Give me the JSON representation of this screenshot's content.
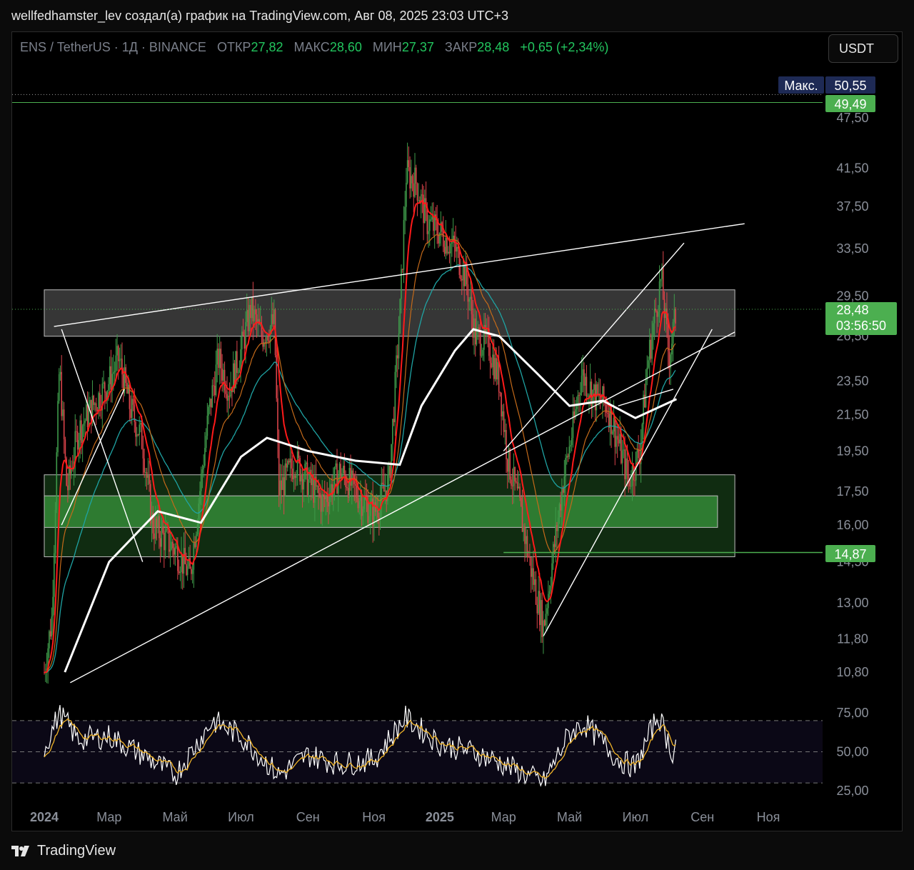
{
  "header": {
    "caption": "wellfedhamster_lev создал(а) график на TradingView.com, Авг 08, 2025 23:03 UTC+3"
  },
  "legend": {
    "symbol": "ENS / TetherUS · 1Д · BINANCE",
    "open_label": "ОТКР",
    "open_value": "27,82",
    "high_label": "МАКС",
    "high_value": "28,60",
    "low_label": "МИН",
    "low_value": "27,37",
    "close_label": "ЗАКР",
    "close_value": "28,48",
    "change": "+0,65 (+2,34%)"
  },
  "currency_button": "USDT",
  "footer": {
    "brand": "TradingView"
  },
  "colors": {
    "up": "#26a69a",
    "down": "#ef5350",
    "green_line": "#4caf50",
    "ema_fast": "#ff1a1a",
    "ema_mid": "#c46a1a",
    "ema_slow": "#1fa3a3",
    "sma_long": "#ffffff",
    "rsi": "#ffffff",
    "rsi_ma": "#f0b429",
    "zone_grey": "#6b6b6b",
    "zone_green": "#2e7d32"
  },
  "chart_data": {
    "type": "candlestick",
    "symbol": "ENS / TetherUS",
    "interval": "1Д",
    "exchange": "BINANCE",
    "y_scale": "log",
    "x_ticks": [
      "2024",
      "Мар",
      "Май",
      "Июл",
      "Сен",
      "Ноя",
      "2025",
      "Мар",
      "Май",
      "Июл",
      "Сен",
      "Ноя"
    ],
    "y_ticks": [
      "47,50",
      "41,50",
      "37,50",
      "33,50",
      "29,50",
      "26,50",
      "23,50",
      "21,50",
      "19,50",
      "17,50",
      "16,00",
      "14,50",
      "13,00",
      "11,80",
      "10,80"
    ],
    "price_labels": [
      {
        "label": "Макс.",
        "value": "50,55"
      },
      {
        "label": "",
        "value": "49,49"
      },
      {
        "label": "",
        "value": "28,48"
      },
      {
        "label": "",
        "value": "03:56:50"
      },
      {
        "label": "",
        "value": "14,87"
      }
    ],
    "close_path": [
      [
        "2024-01-01",
        10.8
      ],
      [
        "2024-01-08",
        12.5
      ],
      [
        "2024-01-15",
        24.5
      ],
      [
        "2024-01-22",
        17.5
      ],
      [
        "2024-02-01",
        20.5
      ],
      [
        "2024-02-15",
        22.0
      ],
      [
        "2024-03-01",
        23.5
      ],
      [
        "2024-03-10",
        25.0
      ],
      [
        "2024-03-20",
        22.0
      ],
      [
        "2024-04-01",
        20.0
      ],
      [
        "2024-04-10",
        16.0
      ],
      [
        "2024-04-20",
        15.5
      ],
      [
        "2024-05-01",
        15.0
      ],
      [
        "2024-05-15",
        14.0
      ],
      [
        "2024-06-01",
        21.5
      ],
      [
        "2024-06-10",
        25.0
      ],
      [
        "2024-06-20",
        23.0
      ],
      [
        "2024-07-01",
        25.5
      ],
      [
        "2024-07-10",
        28.5
      ],
      [
        "2024-07-20",
        26.5
      ],
      [
        "2024-08-01",
        27.5
      ],
      [
        "2024-08-05",
        17.5
      ],
      [
        "2024-08-20",
        19.0
      ],
      [
        "2024-09-01",
        18.0
      ],
      [
        "2024-09-15",
        17.0
      ],
      [
        "2024-10-01",
        18.5
      ],
      [
        "2024-10-15",
        17.5
      ],
      [
        "2024-11-01",
        16.5
      ],
      [
        "2024-11-15",
        18.0
      ],
      [
        "2024-11-25",
        28.0
      ],
      [
        "2024-12-01",
        41.0
      ],
      [
        "2024-12-10",
        40.0
      ],
      [
        "2024-12-20",
        36.0
      ],
      [
        "2025-01-01",
        35.0
      ],
      [
        "2025-01-15",
        33.5
      ],
      [
        "2025-01-25",
        31.0
      ],
      [
        "2025-02-03",
        26.5
      ],
      [
        "2025-02-15",
        26.0
      ],
      [
        "2025-02-25",
        23.5
      ],
      [
        "2025-03-05",
        19.0
      ],
      [
        "2025-03-15",
        17.0
      ],
      [
        "2025-03-25",
        14.5
      ],
      [
        "2025-04-07",
        12.2
      ],
      [
        "2025-04-15",
        14.5
      ],
      [
        "2025-04-25",
        18.0
      ],
      [
        "2025-05-05",
        21.0
      ],
      [
        "2025-05-12",
        24.0
      ],
      [
        "2025-05-25",
        22.5
      ],
      [
        "2025-06-05",
        22.0
      ],
      [
        "2025-06-15",
        20.0
      ],
      [
        "2025-06-25",
        18.0
      ],
      [
        "2025-07-05",
        19.5
      ],
      [
        "2025-07-12",
        24.5
      ],
      [
        "2025-07-20",
        28.5
      ],
      [
        "2025-07-25",
        31.0
      ],
      [
        "2025-08-01",
        25.0
      ],
      [
        "2025-08-08",
        28.48
      ]
    ],
    "sma_long": [
      [
        "2024-01-20",
        10.8
      ],
      [
        "2024-03-01",
        14.5
      ],
      [
        "2024-04-15",
        16.6
      ],
      [
        "2024-05-25",
        16.1
      ],
      [
        "2024-07-01",
        19.2
      ],
      [
        "2024-07-25",
        20.2
      ],
      [
        "2024-09-01",
        19.5
      ],
      [
        "2024-10-15",
        19.0
      ],
      [
        "2024-11-25",
        18.8
      ],
      [
        "2024-12-15",
        22.0
      ],
      [
        "2025-01-15",
        25.5
      ],
      [
        "2025-02-01",
        27.0
      ],
      [
        "2025-02-25",
        26.5
      ],
      [
        "2025-04-01",
        24.0
      ],
      [
        "2025-05-01",
        22.0
      ],
      [
        "2025-06-01",
        22.3
      ],
      [
        "2025-07-01",
        21.3
      ],
      [
        "2025-08-08",
        22.4
      ]
    ],
    "horizontal_levels": [
      {
        "value": 49.49,
        "style": "green"
      },
      {
        "value": 50.55,
        "style": "dotted"
      },
      {
        "value": 28.48,
        "style": "green-dotted"
      },
      {
        "value": 14.87,
        "style": "green-short"
      }
    ],
    "zones": [
      {
        "type": "grey",
        "from": 26.5,
        "to": 30.0,
        "x_from": "2024-01-01",
        "x_to": "2025-10-01"
      },
      {
        "type": "green",
        "from": 14.7,
        "to": 18.3,
        "x_from": "2024-01-01",
        "x_to": "2025-10-01"
      },
      {
        "type": "green-inner",
        "from": 15.9,
        "to": 17.3,
        "x_from": "2024-01-01",
        "x_to": "2025-09-15"
      }
    ],
    "rsi": {
      "levels": [
        "75,00",
        "50,00",
        "25,00"
      ],
      "range": [
        25,
        75
      ],
      "path": [
        [
          "2024-01-01",
          52
        ],
        [
          "2024-01-15",
          75
        ],
        [
          "2024-02-01",
          58
        ],
        [
          "2024-03-01",
          60
        ],
        [
          "2024-04-01",
          48
        ],
        [
          "2024-05-01",
          35
        ],
        [
          "2024-06-05",
          70
        ],
        [
          "2024-07-01",
          60
        ],
        [
          "2024-08-05",
          35
        ],
        [
          "2024-09-01",
          48
        ],
        [
          "2024-10-01",
          42
        ],
        [
          "2024-11-01",
          45
        ],
        [
          "2024-11-30",
          72
        ],
        [
          "2025-01-01",
          55
        ],
        [
          "2025-02-01",
          50
        ],
        [
          "2025-03-01",
          42
        ],
        [
          "2025-04-07",
          30
        ],
        [
          "2025-05-01",
          62
        ],
        [
          "2025-05-15",
          68
        ],
        [
          "2025-06-15",
          45
        ],
        [
          "2025-07-01",
          40
        ],
        [
          "2025-07-22",
          74
        ],
        [
          "2025-08-05",
          48
        ],
        [
          "2025-08-08",
          58
        ]
      ]
    }
  }
}
